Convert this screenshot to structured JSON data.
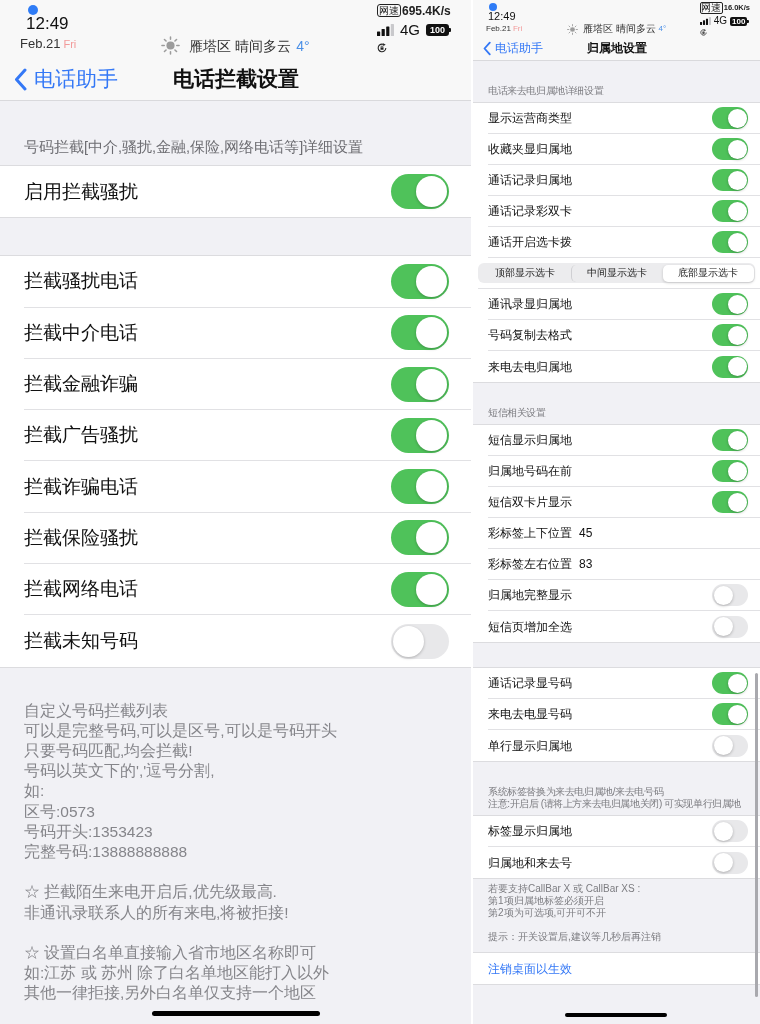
{
  "phones": [
    {
      "status_bar": {
        "time": "12:49",
        "date": "Feb.21",
        "weekday": "Fri",
        "location_weather": "雁塔区 晴间多云",
        "temperature": "4°",
        "speed_badge": "网速",
        "speed": "695.4K/s",
        "network": "4G",
        "battery": "100"
      },
      "nav": {
        "back": "电话助手",
        "title": "电话拦截设置"
      },
      "sections": [
        {
          "header": [
            "号码拦截[中介,骚扰,金融,保险,网络电话等]详细设置"
          ],
          "rows": [
            {
              "kind": "toggle",
              "label": "启用拦截骚扰",
              "on": true
            }
          ]
        },
        {
          "rows": [
            {
              "kind": "toggle",
              "label": "拦截骚扰电话",
              "on": true
            },
            {
              "kind": "toggle",
              "label": "拦截中介电话",
              "on": true
            },
            {
              "kind": "toggle",
              "label": "拦截金融诈骗",
              "on": true
            },
            {
              "kind": "toggle",
              "label": "拦截广告骚扰",
              "on": true
            },
            {
              "kind": "toggle",
              "label": "拦截诈骗电话",
              "on": true
            },
            {
              "kind": "toggle",
              "label": "拦截保险骚扰",
              "on": true
            },
            {
              "kind": "toggle",
              "label": "拦截网络电话",
              "on": true
            },
            {
              "kind": "toggle",
              "label": "拦截未知号码",
              "on": false
            }
          ],
          "footer": [
            [
              "自定义号码拦截列表",
              "可以是完整号码,可以是区号,可以是号码开头",
              "只要号码匹配,均会拦截!",
              "号码以英文下的','逗号分割,",
              "如:",
              "区号:0573",
              "号码开头:1353423",
              "完整号码:13888888888"
            ],
            [
              "☆ 拦截陌生来电开启后,优先级最高.",
              "非通讯录联系人的所有来电,将被拒接!"
            ],
            [
              "☆ 设置白名单直接输入省市地区名称即可",
              "如:江苏 或 苏州 除了白名单地区能打入以外",
              "其他一律拒接,另外白名单仅支持一个地区"
            ]
          ]
        }
      ]
    },
    {
      "status_bar": {
        "time": "12:49",
        "date": "Feb.21",
        "weekday": "Fri",
        "location_weather": "雁塔区 晴间多云",
        "temperature": "4°",
        "speed_badge": "网速",
        "speed": "16.0K/s",
        "network": "4G",
        "battery": "100"
      },
      "nav": {
        "back": "电话助手",
        "title": "归属地设置"
      },
      "sections": [
        {
          "header": [
            "电话来去电归属地详细设置"
          ],
          "rows": [
            {
              "kind": "toggle",
              "label": "显示运营商类型",
              "on": true
            },
            {
              "kind": "toggle",
              "label": "收藏夹显归属地",
              "on": true
            },
            {
              "kind": "toggle",
              "label": "通话记录归属地",
              "on": true
            },
            {
              "kind": "toggle",
              "label": "通话记录彩双卡",
              "on": true
            },
            {
              "kind": "toggle",
              "label": "通话开启选卡拨",
              "on": true
            },
            {
              "kind": "segmented",
              "segments": [
                {
                  "label": "顶部显示选卡",
                  "selected": false
                },
                {
                  "label": "中间显示选卡",
                  "selected": false
                },
                {
                  "label": "底部显示选卡",
                  "selected": true
                }
              ]
            },
            {
              "kind": "toggle",
              "label": "通讯录显归属地",
              "on": true
            },
            {
              "kind": "toggle",
              "label": "号码复制去格式",
              "on": true
            },
            {
              "kind": "toggle",
              "label": "来电去电归属地",
              "on": true
            }
          ]
        },
        {
          "header": [
            "短信相关设置"
          ],
          "rows": [
            {
              "kind": "toggle",
              "label": "短信显示归属地",
              "on": true
            },
            {
              "kind": "toggle",
              "label": "归属地号码在前",
              "on": true
            },
            {
              "kind": "toggle",
              "label": "短信双卡片显示",
              "on": true
            },
            {
              "kind": "value",
              "label": "彩标签上下位置",
              "value": "45"
            },
            {
              "kind": "value",
              "label": "彩标签左右位置",
              "value": "83"
            },
            {
              "kind": "toggle",
              "label": "归属地完整显示",
              "on": false
            },
            {
              "kind": "toggle",
              "label": "短信页增加全选",
              "on": false
            }
          ]
        },
        {
          "rows": [
            {
              "kind": "toggle",
              "label": "通话记录显号码",
              "on": true
            },
            {
              "kind": "toggle",
              "label": "来电去电显号码",
              "on": true
            },
            {
              "kind": "toggle",
              "label": "单行显示归属地",
              "on": false
            }
          ]
        },
        {
          "header": [
            "系统标签替换为来去电归属地/来去电号码",
            "注意:开启后 (请将上方来去电归属地关闭) 可实现单行归属地"
          ],
          "rows": [
            {
              "kind": "toggle",
              "label": "标签显示归属地",
              "on": false
            },
            {
              "kind": "toggle",
              "label": "归属地和来去号",
              "on": false
            }
          ],
          "footer": [
            [
              "若要支持CallBar X 或 CallBar XS :",
              "第1项归属地标签必须开启",
              "第2项为可选项,可开可不开"
            ],
            [
              "提示：开关设置后,建议等几秒后再注销"
            ]
          ]
        },
        {
          "rows": [
            {
              "kind": "link",
              "label": "注销桌面以生效"
            }
          ]
        }
      ]
    }
  ]
}
